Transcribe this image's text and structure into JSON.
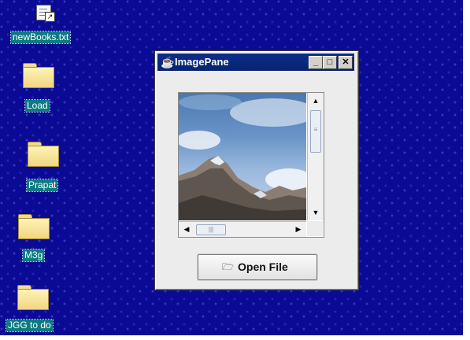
{
  "desktop": {
    "background_color": "#0a0a94",
    "label_color": "#0d7a82",
    "icons": [
      {
        "label": "newBooks.txt",
        "icon": "text-file-shortcut-icon"
      },
      {
        "label": "Load",
        "icon": "folder-icon"
      },
      {
        "label": "Prapat",
        "icon": "folder-icon"
      },
      {
        "label": "M3g",
        "icon": "folder-icon"
      },
      {
        "label": "JGG to do",
        "icon": "folder-icon"
      }
    ]
  },
  "window": {
    "title": "ImagePane",
    "title_icon": "java-cup-icon",
    "controls": {
      "minimize_icon": "minimize-icon",
      "maximize_icon": "maximize-icon",
      "close_icon": "close-icon"
    },
    "image": {
      "description_icon": "mountain-landscape-image",
      "vertical_scroll": {
        "up_icon": "arrow-up-icon",
        "down_icon": "arrow-down-icon",
        "position": 0.1
      },
      "horizontal_scroll": {
        "left_icon": "arrow-left-icon",
        "right_icon": "arrow-right-icon",
        "position": 0.1
      }
    },
    "open_button": {
      "label": "Open File",
      "icon": "folder-open-icon"
    }
  }
}
